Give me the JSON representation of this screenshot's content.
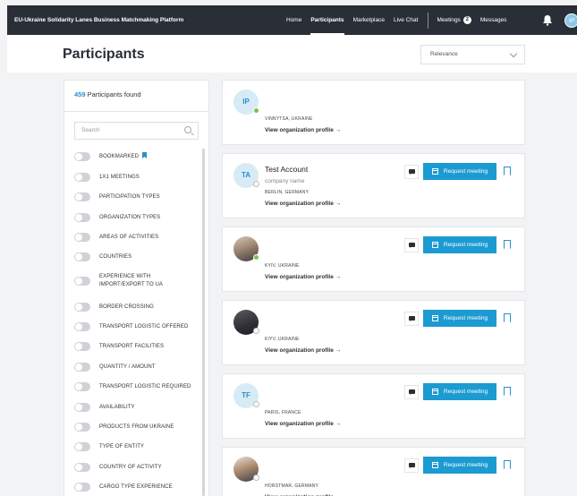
{
  "app": {
    "title": "EU-Ukraine Solidarity Lanes Business Matchmaking Platform"
  },
  "nav": {
    "home": "Home",
    "participants": "Participants",
    "marketplace": "Marketplace",
    "live_chat": "Live Chat",
    "meetings": "Meetings",
    "meetings_count": "2",
    "messages": "Messages",
    "user_initials": "IP"
  },
  "page": {
    "title": "Participants"
  },
  "sort": {
    "value": "Relevance"
  },
  "results": {
    "count": "459",
    "label": "Participants found"
  },
  "search": {
    "placeholder": "Search"
  },
  "filters": [
    "BOOKMARKED",
    "1X1 MEETINGS",
    "PARTICIPATION TYPES",
    "ORGANIZATION TYPES",
    "AREAS OF ACTIVITIES",
    "COUNTRIES",
    "EXPERIENCE WITH IMPORT/EXPORT TO UA",
    "BORDER CROSSING",
    "TRANSPORT LOGISTIC OFFERED",
    "TRANSPORT FACILITIES",
    "QUANTITY / AMOUNT",
    "TRANSPORT LOGISTIC REQUIRED",
    "AVAILABILITY",
    "PRODUCTS FROM UKRAINE",
    "TYPE OF ENTITY",
    "COUNTRY OF ACTIVITY",
    "CARGO TYPE EXPERIENCE"
  ],
  "card_actions": {
    "view_profile": "View organization profile",
    "request_meeting": "Request meeting"
  },
  "participants": [
    {
      "initials": "IP",
      "name": "",
      "company": "",
      "location": "VINNYTSA, UKRAINE",
      "status": "online"
    },
    {
      "initials": "TA",
      "name": "Test Account",
      "company": "company name",
      "location": "BERLIN, GERMANY",
      "status": "offline"
    },
    {
      "initials": "",
      "name": "",
      "company": "",
      "location": "KYIV, UKRAINE",
      "status": "online"
    },
    {
      "initials": "",
      "name": "",
      "company": "",
      "location": "KIYV, UKRAINE",
      "status": "offline"
    },
    {
      "initials": "TF",
      "name": "",
      "company": "",
      "location": "PARIS, FRANCE",
      "status": "offline"
    },
    {
      "initials": "",
      "name": "",
      "company": "",
      "location": "HORSTMAR, GERMANY",
      "status": "offline"
    }
  ]
}
